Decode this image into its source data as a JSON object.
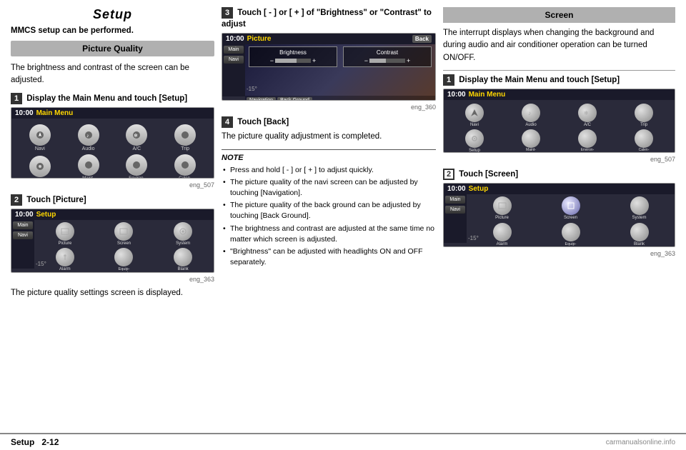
{
  "page": {
    "title": "Setup",
    "subtitle": "MMCS setup can be performed.",
    "footer": {
      "prefix": "Setup",
      "page": "2-12",
      "watermark": "carmanualsonline.info"
    }
  },
  "left_col": {
    "picture_quality": {
      "header": "Picture Quality",
      "description": "The brightness and contrast of the screen can be adjusted.",
      "step1": {
        "num": "1",
        "text": "Display the Main Menu and touch [Setup]",
        "caption": "eng_507"
      },
      "step2": {
        "num": "2",
        "text": "Touch [Picture]",
        "caption": "eng_363",
        "footnote": "The picture quality settings screen is displayed."
      }
    }
  },
  "mid_col": {
    "step3": {
      "num": "3",
      "text": "Touch [ - ] or [ + ] of \"Brightness\" or \"Contrast\" to adjust",
      "caption": "eng_360"
    },
    "step4": {
      "num": "4",
      "text": "Touch [Back]",
      "complete_text": "The picture quality adjustment is completed.",
      "note_title": "NOTE",
      "notes": [
        "Press and hold [ - ] or [ + ] to adjust quickly.",
        "The picture quality of the navi screen can be adjusted by touching [Navigation].",
        "The picture quality of the back ground can be adjusted by touching [Back Ground].",
        "The brightness and contrast are adjusted at the same time no matter which screen is adjusted.",
        "\"Brightness\" can be adjusted with headlights ON and OFF separately."
      ]
    }
  },
  "right_col": {
    "section_header": "Screen",
    "description": "The interrupt displays when changing the background and during audio and air conditioner operation can be turned ON/OFF.",
    "step1": {
      "num": "1",
      "text": "Display the Main Menu and touch [Setup]",
      "caption": "eng_507"
    },
    "step2": {
      "num": "2",
      "text": "Touch [Screen]",
      "caption": "eng_363"
    }
  },
  "screens": {
    "main_menu": {
      "time": "10:00",
      "label": "Main Menu",
      "items": [
        {
          "label": "Navi"
        },
        {
          "label": "Audio"
        },
        {
          "label": "A/C"
        },
        {
          "label": "Trip"
        },
        {
          "label": "Setup"
        },
        {
          "label": "Maint-\nnance"
        },
        {
          "label": "Environ-\nment"
        },
        {
          "label": "Calen-\ndar"
        }
      ]
    },
    "setup_menu": {
      "time": "10:00",
      "label": "Setup",
      "sidebar_items": [
        "Main",
        "Navi"
      ],
      "items": [
        {
          "label": "Picture"
        },
        {
          "label": "Screen"
        },
        {
          "label": "System"
        },
        {
          "label": "Alarm"
        },
        {
          "label": "Equip-\nment"
        },
        {
          "label": "Blank"
        }
      ],
      "temp": "-15°"
    },
    "brightness": {
      "time": "10:00",
      "label": "Picture",
      "back": "Back",
      "controls": [
        {
          "name": "Brightness",
          "value": "-"
        },
        {
          "name": "Contrast",
          "value": "+"
        }
      ],
      "bottom_btns": [
        "Navigation",
        "Back Ground"
      ],
      "temp": "-15°",
      "caption": "eng_360"
    }
  }
}
